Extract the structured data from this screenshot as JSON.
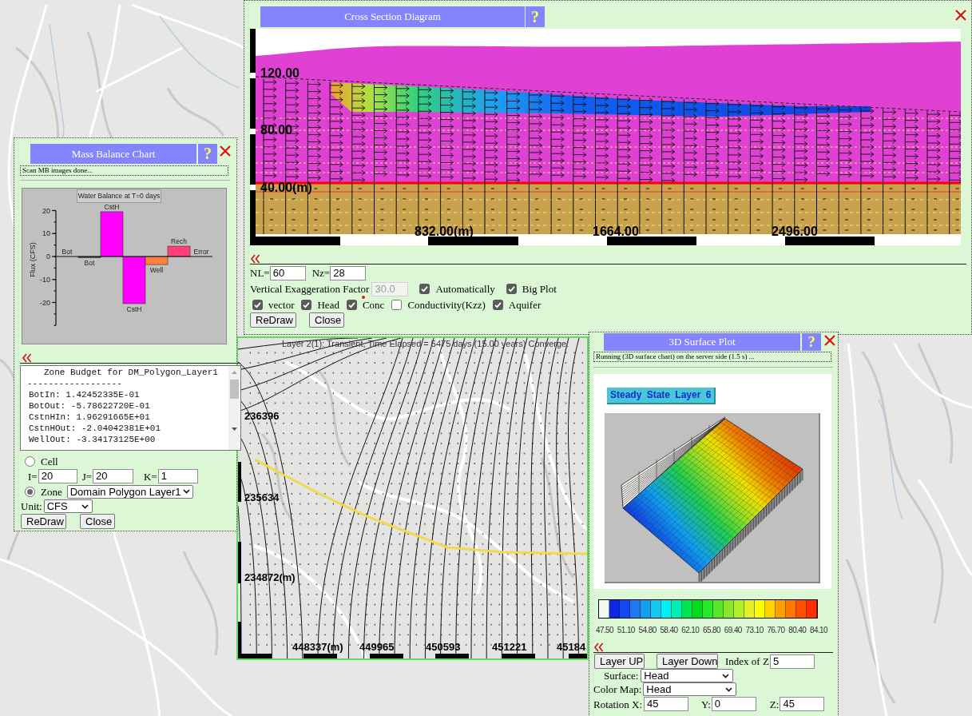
{
  "cross_section": {
    "title": "Cross Section Diagram",
    "help": "?",
    "y_labels": [
      "120.00",
      "80.00",
      "40.00(m)"
    ],
    "x_labels": [
      "832.00(m)",
      "1664.00",
      "2496.00"
    ],
    "grid_fields": [
      {
        "label": "NL=",
        "value": "60"
      },
      {
        "label": "Nz=",
        "value": "28"
      }
    ],
    "exaggeration": {
      "label": "Vertical Exaggeration Factor",
      "value": "30.0",
      "disabled": true
    },
    "plot_options": [
      {
        "label": "Automatically",
        "checked": true
      },
      {
        "label": "Big Plot",
        "checked": true
      }
    ],
    "layers": [
      {
        "label": "vector",
        "checked": true,
        "marked": false
      },
      {
        "label": "Head",
        "checked": true,
        "marked": false
      },
      {
        "label": "Conc",
        "checked": true,
        "marked": true
      },
      {
        "label": "Conductivity(Kzz)",
        "checked": false,
        "marked": false
      },
      {
        "label": "Aquifer",
        "checked": true,
        "marked": false
      }
    ],
    "buttons": [
      "ReDraw",
      "Close"
    ]
  },
  "mass_balance": {
    "title": "Mass Balance Chart",
    "help": "?",
    "status": "Scan MB images done...",
    "chart_data": {
      "type": "bar",
      "title": "Water Balance at T=0 days",
      "ylabel": "Flux (CFS)",
      "series": [
        {
          "name": "Bot",
          "values": [
            0,
            null,
            null,
            null,
            null,
            null,
            null
          ]
        },
        {
          "name": "Bot",
          "color": "#2f5f2f",
          "values": [
            null,
            -0.5,
            null,
            null,
            null,
            null,
            null
          ]
        },
        {
          "name": "CstH",
          "color": "#ff00ff",
          "values": [
            null,
            null,
            19.5,
            null,
            null,
            null,
            null
          ]
        },
        {
          "name": "CstH",
          "color": "#ff00ff",
          "values": [
            null,
            null,
            null,
            -20.5,
            null,
            null,
            null
          ]
        },
        {
          "name": "Well",
          "color": "#ff8040",
          "values": [
            null,
            null,
            null,
            null,
            -3.5,
            null,
            null
          ]
        },
        {
          "name": "Rech",
          "color": "#ff4078",
          "values": [
            null,
            null,
            null,
            null,
            null,
            4.5,
            null
          ]
        },
        {
          "name": "Error",
          "values": [
            null,
            null,
            null,
            null,
            null,
            null,
            0
          ]
        }
      ],
      "stacked": true,
      "ylim": [
        -30,
        20
      ],
      "yticks": [
        -20,
        -10,
        0,
        10,
        20
      ]
    },
    "budget": {
      "heading": "Zone Budget for DM_Polygon_Layer1",
      "rule": "------------------",
      "lines": [
        "BotIn: 1.42452335E-01",
        "BotOut: -5.78622720E-01",
        "CstnHIn: 1.96291665E+01",
        "CstnHOut: -2.04042381E+01",
        "WellOut: -3.34173125E+00"
      ]
    },
    "cell": {
      "label": "Cell",
      "selected": false,
      "indices": [
        {
          "label": "I=",
          "value": "20"
        },
        {
          "label": "J=",
          "value": "20"
        },
        {
          "label": "K=",
          "value": "1"
        }
      ]
    },
    "zone": {
      "label": "Zone",
      "selected": true,
      "value": "Domain Polygon Layer1"
    },
    "unit": {
      "label": "Unit:",
      "value": "CFS"
    },
    "buttons": [
      "ReDraw",
      "Close"
    ]
  },
  "contour_map": {
    "header": "Layer 2(1): Transient, Time Elapsed = 5475 days (15.00 years) Converge:",
    "y_labels": [
      "236396",
      "235634",
      "234872(m)"
    ],
    "x_labels": [
      "448337(m)",
      "449965",
      "450593",
      "451221",
      "45184"
    ]
  },
  "surface_plot": {
    "title": "3D Surface Plot",
    "help": "?",
    "status": "Running (3D surface chart) on the server side (1.5 s) ...",
    "caption": "Steady State Layer 6",
    "legend": {
      "swatches": [
        {
          "color": "#f2f8f2"
        },
        {
          "color": "#0a28e6"
        },
        {
          "color": "#1448f0"
        },
        {
          "color": "#1e78f0"
        },
        {
          "color": "#14a0f0"
        },
        {
          "color": "#14c8f0"
        },
        {
          "color": "#00f0f0"
        },
        {
          "color": "#00f0b4"
        },
        {
          "color": "#00e650"
        },
        {
          "color": "#00dc1e"
        },
        {
          "color": "#28e628"
        },
        {
          "color": "#5ae628"
        },
        {
          "color": "#8ce628"
        },
        {
          "color": "#b4f028"
        },
        {
          "color": "#e6f028"
        },
        {
          "color": "#ffff00"
        },
        {
          "color": "#ffd200"
        },
        {
          "color": "#ffa000"
        },
        {
          "color": "#ff7800"
        },
        {
          "color": "#ff5000"
        },
        {
          "color": "#ff3000"
        }
      ],
      "labels": [
        "47.50",
        "51.10",
        "54.80",
        "58.40",
        "62.10",
        "65.80",
        "69.40",
        "73.10",
        "76.70",
        "80.40",
        "84.10"
      ]
    },
    "buttons": [
      "Layer UP",
      "Layer Down"
    ],
    "index_z": {
      "label": "Index of Z",
      "value": "5"
    },
    "selects": [
      {
        "label": "Surface:",
        "value": "Head"
      },
      {
        "label": "Color Map:",
        "value": "Head"
      }
    ],
    "rotation": [
      {
        "label": "Rotation X:",
        "value": "45"
      },
      {
        "label": "Y:",
        "value": "0"
      },
      {
        "label": "Z:",
        "value": "45"
      }
    ]
  }
}
